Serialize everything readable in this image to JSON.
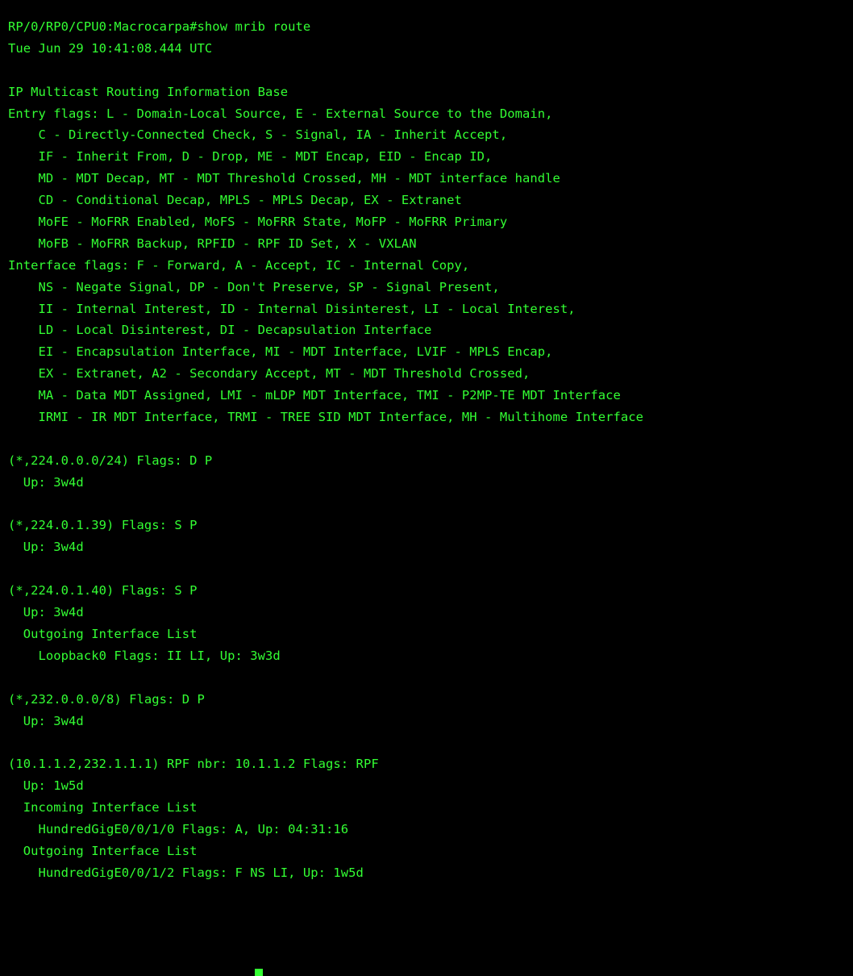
{
  "terminal": {
    "text_color": "#33ff33",
    "background_color": "#000000",
    "lines": [
      "RP/0/RP0/CPU0:Macrocarpa#show mrib route",
      "Tue Jun 29 10:41:08.444 UTC",
      "",
      "IP Multicast Routing Information Base",
      "Entry flags: L - Domain-Local Source, E - External Source to the Domain,",
      "    C - Directly-Connected Check, S - Signal, IA - Inherit Accept,",
      "    IF - Inherit From, D - Drop, ME - MDT Encap, EID - Encap ID,",
      "    MD - MDT Decap, MT - MDT Threshold Crossed, MH - MDT interface handle",
      "    CD - Conditional Decap, MPLS - MPLS Decap, EX - Extranet",
      "    MoFE - MoFRR Enabled, MoFS - MoFRR State, MoFP - MoFRR Primary",
      "    MoFB - MoFRR Backup, RPFID - RPF ID Set, X - VXLAN",
      "Interface flags: F - Forward, A - Accept, IC - Internal Copy,",
      "    NS - Negate Signal, DP - Don't Preserve, SP - Signal Present,",
      "    II - Internal Interest, ID - Internal Disinterest, LI - Local Interest,",
      "    LD - Local Disinterest, DI - Decapsulation Interface",
      "    EI - Encapsulation Interface, MI - MDT Interface, LVIF - MPLS Encap,",
      "    EX - Extranet, A2 - Secondary Accept, MT - MDT Threshold Crossed,",
      "    MA - Data MDT Assigned, LMI - mLDP MDT Interface, TMI - P2MP-TE MDT Interface",
      "    IRMI - IR MDT Interface, TRMI - TREE SID MDT Interface, MH - Multihome Interface",
      "",
      "(*,224.0.0.0/24) Flags: D P",
      "  Up: 3w4d",
      "",
      "(*,224.0.1.39) Flags: S P",
      "  Up: 3w4d",
      "",
      "(*,224.0.1.40) Flags: S P",
      "  Up: 3w4d",
      "  Outgoing Interface List",
      "    Loopback0 Flags: II LI, Up: 3w3d",
      "",
      "(*,232.0.0.0/8) Flags: D P",
      "  Up: 3w4d",
      "",
      "(10.1.1.2,232.1.1.1) RPF nbr: 10.1.1.2 Flags: RPF",
      "  Up: 1w5d",
      "  Incoming Interface List",
      "    HundredGigE0/0/1/0 Flags: A, Up: 04:31:16",
      "  Outgoing Interface List",
      "    HundredGigE0/0/1/2 Flags: F NS LI, Up: 1w5d"
    ]
  }
}
